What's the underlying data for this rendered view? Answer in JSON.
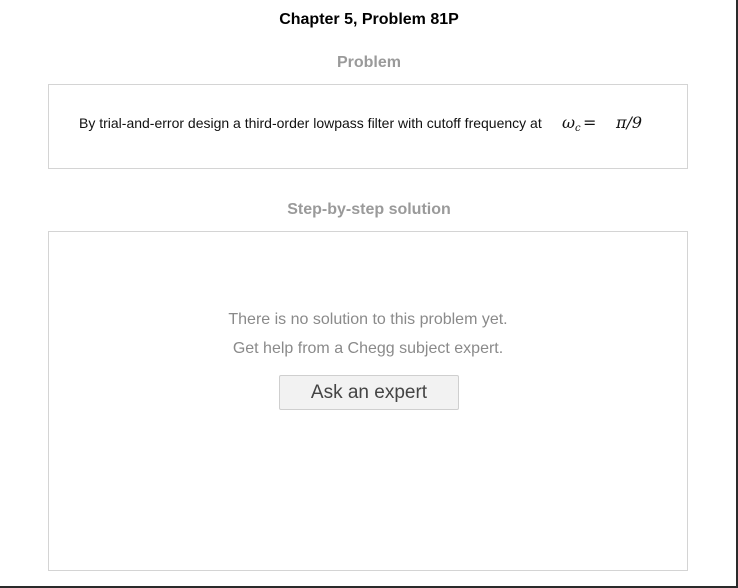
{
  "page": {
    "title": "Chapter 5, Problem 81P"
  },
  "problem": {
    "heading": "Problem",
    "text": "By trial-and-error design a third-order lowpass filter with cutoff frequency at",
    "math": {
      "omega": "ω",
      "subscript": "c",
      "equals": "=",
      "value": "π/9"
    }
  },
  "solution": {
    "heading": "Step-by-step solution",
    "message_line1": "There is no solution to this problem yet.",
    "message_line2": "Get help from a Chegg subject expert.",
    "button_label": "Ask an expert"
  },
  "colors": {
    "heading_gray": "#9a9a9a",
    "message_gray": "#8a8a8a",
    "border": "#d4d4d4",
    "button_bg": "#f2f2f2"
  }
}
